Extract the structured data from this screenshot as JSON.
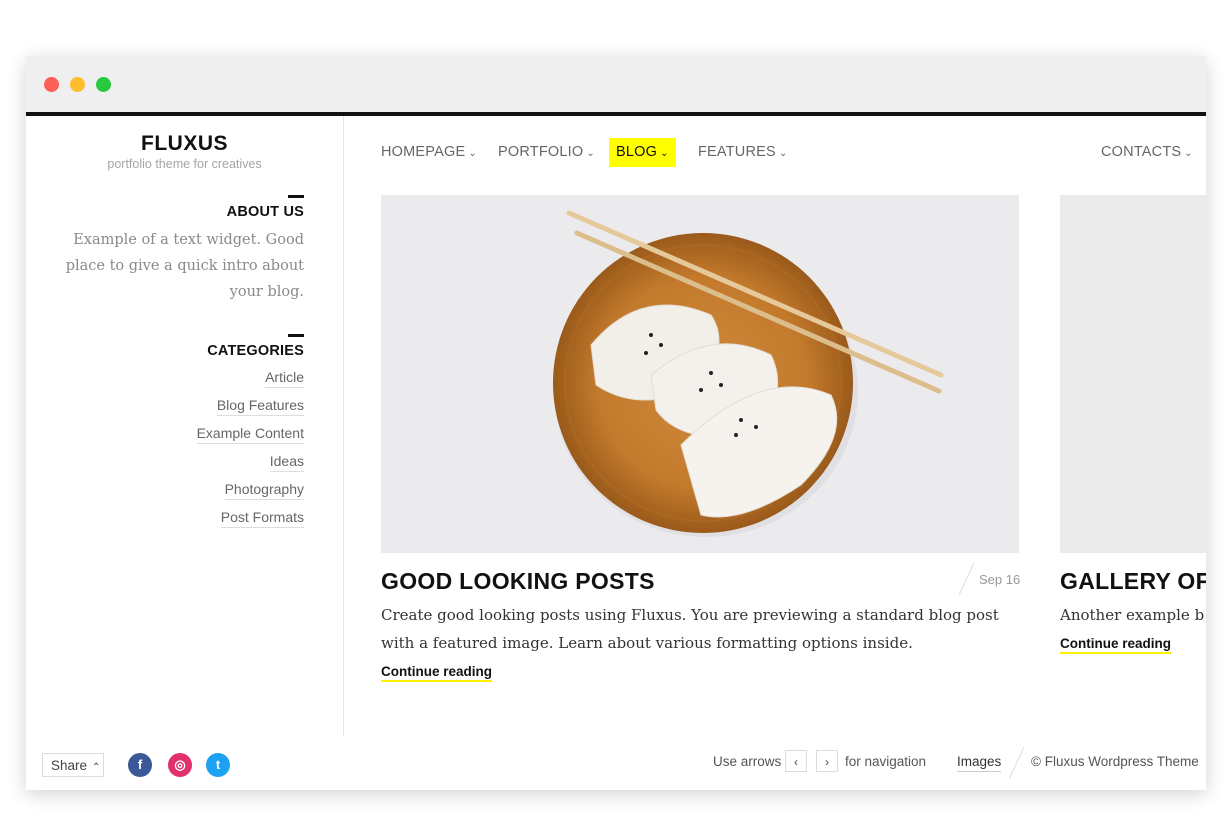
{
  "window": {
    "traffic_lights": [
      "close",
      "minimize",
      "zoom"
    ],
    "colors": {
      "close": "#fe5f57",
      "minimize": "#febc2e",
      "zoom": "#28c840"
    }
  },
  "brand": {
    "title": "FLUXUS",
    "subtitle": "portfolio theme for creatives"
  },
  "nav": {
    "items": [
      {
        "label": "HOMEPAGE",
        "active": false
      },
      {
        "label": "PORTFOLIO",
        "active": false
      },
      {
        "label": "BLOG",
        "active": true
      },
      {
        "label": "FEATURES",
        "active": false
      },
      {
        "label": "CONTACTS",
        "active": false
      }
    ],
    "active_color": "#ffff00"
  },
  "sidebar": {
    "about": {
      "title": "ABOUT US",
      "text": "Example of a text widget. Good place to give a quick intro about your blog."
    },
    "categories": {
      "title": "CATEGORIES",
      "items": [
        "Article",
        "Blog Features",
        "Example Content",
        "Ideas",
        "Photography",
        "Post Formats"
      ]
    }
  },
  "posts": [
    {
      "title": "GOOD LOOKING POSTS",
      "date": "Sep 16",
      "excerpt_line1": "Create good looking posts using Fluxus. You are previewing a standard blog post",
      "excerpt_line2": "with a featured image. Learn about various formatting options inside.",
      "continue_label": "Continue reading"
    },
    {
      "title": "GALLERY OF '",
      "excerpt_line1": "Another example b",
      "continue_label": "Continue reading"
    }
  ],
  "footer": {
    "share_label": "Share",
    "social": [
      {
        "icon": "facebook-icon",
        "glyph": "f"
      },
      {
        "icon": "instagram-icon",
        "glyph": "◎"
      },
      {
        "icon": "twitter-icon",
        "glyph": "t"
      }
    ],
    "nav_hint_prefix": "Use arrows",
    "nav_hint_suffix": "for navigation",
    "prev_glyph": "‹",
    "next_glyph": "›",
    "images_link": "Images",
    "copyright": "© Fluxus Wordpress Theme"
  }
}
